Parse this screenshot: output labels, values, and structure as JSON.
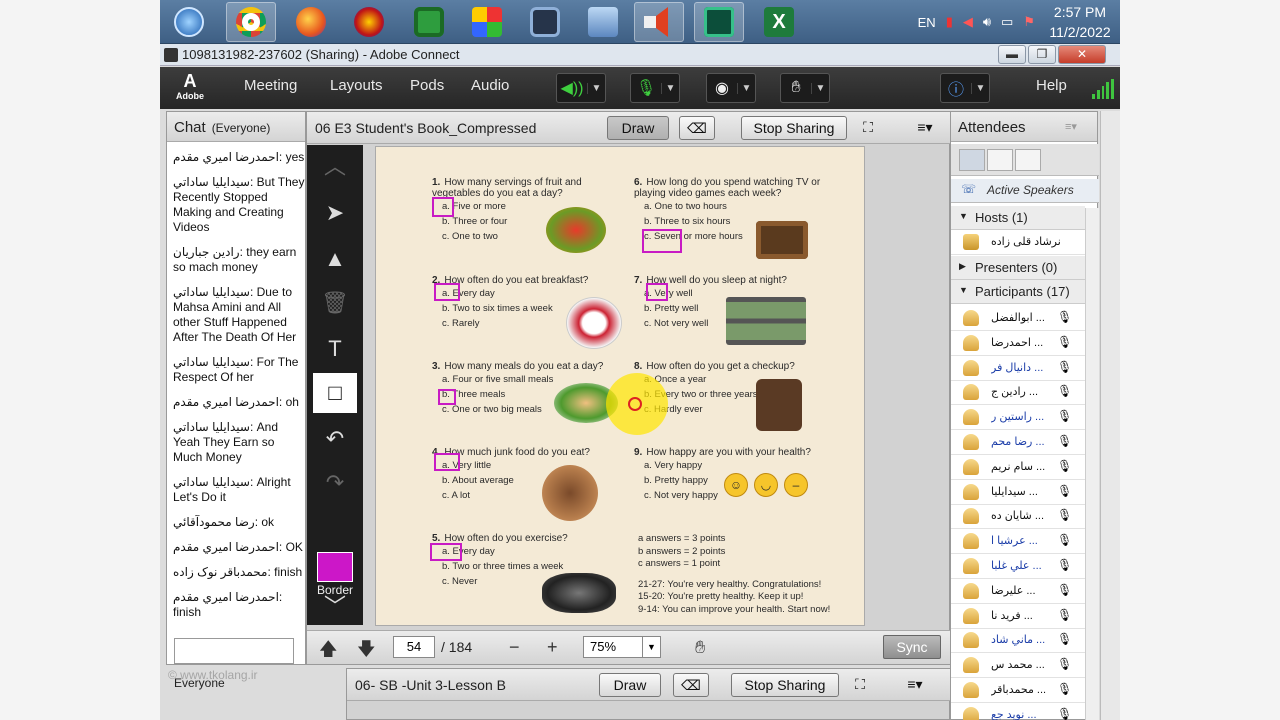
{
  "tray": {
    "lang": "EN",
    "time": "2:57 PM",
    "date": "11/2/2022"
  },
  "window": {
    "title": "1098131982-237602 (Sharing) - Adobe Connect",
    "minimize": "▬",
    "restore": "❐",
    "close": "✕"
  },
  "menubar": {
    "logo": "Adobe",
    "items": [
      "Meeting",
      "Layouts",
      "Pods",
      "Audio"
    ],
    "help": "Help"
  },
  "chat": {
    "title": "Chat",
    "scope": "(Everyone)",
    "messages": [
      "احمدرضا اميري مقدم: yes",
      "سيدايليا ساداتي: But They Recently Stopped Making and Creating Videos",
      "رادين جباريان: they earn so mach money",
      "سيدايليا ساداتي: Due to Mahsa Amini and All other Stuff Happened After The Death Of Her",
      "سيدايليا ساداتي: For The Respect Of her",
      "احمدرضا اميري مقدم: oh",
      "سيدايليا ساداتي: And Yeah They Earn so Much Money",
      "سيدايليا ساداتي: Alright Let's Do it",
      "رضا محمودآقائي: ok",
      "احمدرضا اميري مقدم: OK",
      "محمدباقر نوک زاده: finish",
      "احمدرضا اميري مقدم: finish"
    ],
    "everyone_label": "Everyone",
    "watermark": "© www.tkolang.ir"
  },
  "share": {
    "title": "06 E3 Student's Book_Compressed",
    "draw": "Draw",
    "stop_sharing": "Stop Sharing",
    "border_label": "Border",
    "page": "54",
    "total": "/ 184",
    "zoom": "75%",
    "sync": "Sync"
  },
  "share2": {
    "title": "06- SB -Unit 3-Lesson B",
    "draw": "Draw",
    "stop_sharing": "Stop Sharing"
  },
  "worksheet": {
    "q1": {
      "num": "1.",
      "text": "How many servings of fruit and vegetables do you eat a day?",
      "a": "a. Five or more",
      "b": "b. Three or four",
      "c": "c. One to two"
    },
    "q2": {
      "num": "2.",
      "text": "How often do you eat breakfast?",
      "a": "a. Every day",
      "b": "b. Two to six times a week",
      "c": "c. Rarely"
    },
    "q3": {
      "num": "3.",
      "text": "How many meals do you eat a day?",
      "a": "a. Four or five small meals",
      "b": "b. Three meals",
      "c": "c. One or two big meals"
    },
    "q4": {
      "num": "4.",
      "text": "How much junk food do you eat?",
      "a": "a. Very little",
      "b": "b. About average",
      "c": "c. A lot"
    },
    "q5": {
      "num": "5.",
      "text": "How often do you exercise?",
      "a": "a. Every day",
      "b": "b. Two or three times a week",
      "c": "c. Never"
    },
    "q6": {
      "num": "6.",
      "text": "How long do you spend watching TV or playing video games each week?",
      "a": "a. One to two hours",
      "b": "b. Three to six hours",
      "c": "c. Seven or more hours"
    },
    "q7": {
      "num": "7.",
      "text": "How well do you sleep at night?",
      "a": "a. Very well",
      "b": "b. Pretty well",
      "c": "c. Not very well"
    },
    "q8": {
      "num": "8.",
      "text": "How often do you get a checkup?",
      "a": "a. Once a year",
      "b": "b. Every two or three years",
      "c": "c. Hardly ever"
    },
    "q9": {
      "num": "9.",
      "text": "How happy are you with your health?",
      "a": "a. Very happy",
      "b": "b. Pretty happy",
      "c": "c. Not very happy"
    },
    "scores": [
      "a answers = 3 points",
      "b answers = 2 points",
      "c answers = 1 point"
    ],
    "results": [
      "21-27: You're very healthy. Congratulations!",
      "15-20: You're pretty healthy. Keep it up!",
      "9-14: You can improve your health. Start now!"
    ]
  },
  "attendees": {
    "title": "Attendees",
    "active_speakers": "Active Speakers",
    "hosts": "Hosts (1)",
    "host_name": "نرشاد قلی زاده",
    "presenters": "Presenters (0)",
    "participants": "Participants (17)",
    "list": [
      {
        "name": "ابوالفضل ...",
        "blue": false
      },
      {
        "name": "احمدرضا ...",
        "blue": false
      },
      {
        "name": "دانيال فر ...",
        "blue": true
      },
      {
        "name": "رادين ج ...",
        "blue": false
      },
      {
        "name": "راستين ر ...",
        "blue": true
      },
      {
        "name": "رضا محم ...",
        "blue": true
      },
      {
        "name": "سام نريم ...",
        "blue": false
      },
      {
        "name": "سيدايليا ...",
        "blue": false
      },
      {
        "name": "شايان ده ...",
        "blue": false
      },
      {
        "name": "عرشيا ا ...",
        "blue": true
      },
      {
        "name": "علي غلبا ...",
        "blue": true
      },
      {
        "name": "عليرضا ...",
        "blue": false
      },
      {
        "name": "فريد نا ...",
        "blue": false
      },
      {
        "name": "ماني شاد ...",
        "blue": true
      },
      {
        "name": "محمد س ...",
        "blue": false
      },
      {
        "name": "محمدباقر ...",
        "blue": false
      },
      {
        "name": "نويد جع ...",
        "blue": true
      }
    ]
  }
}
